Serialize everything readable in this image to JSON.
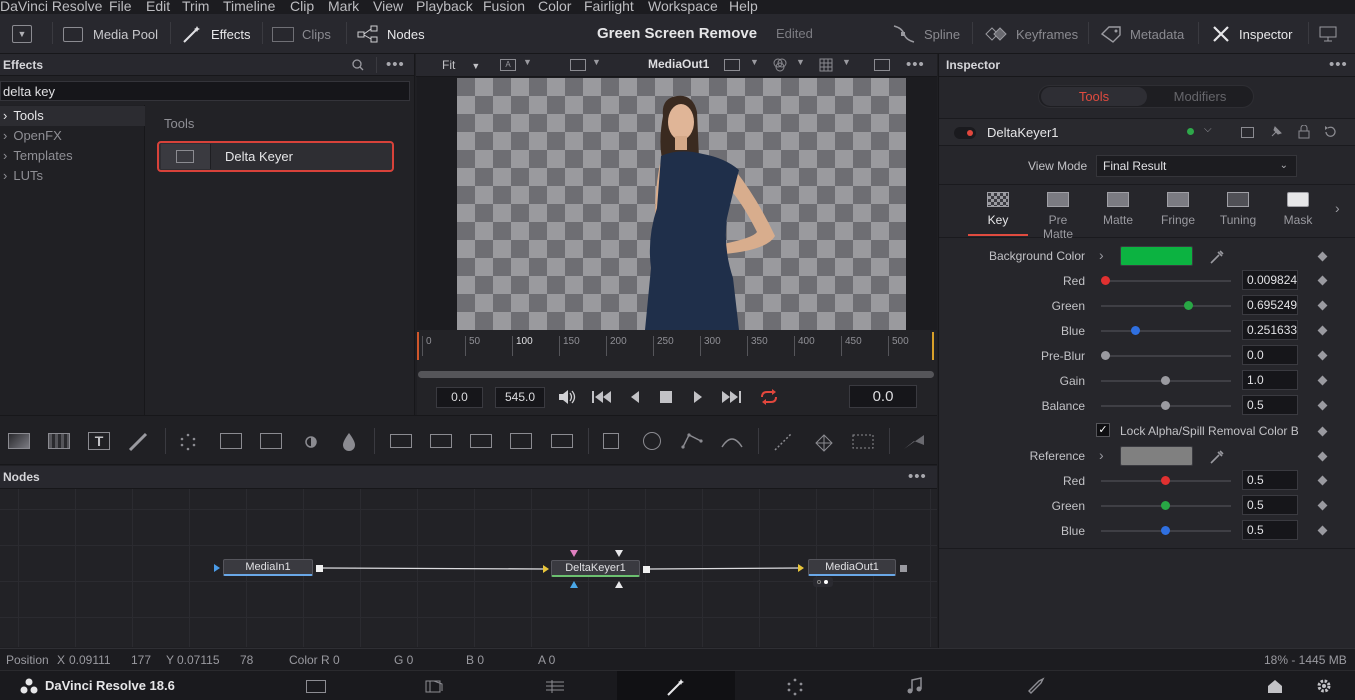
{
  "menu": [
    "DaVinci Resolve",
    "File",
    "Edit",
    "Trim",
    "Timeline",
    "Clip",
    "Mark",
    "View",
    "Playback",
    "Fusion",
    "Color",
    "Fairlight",
    "Workspace",
    "Help"
  ],
  "toolbar": {
    "media_pool": "Media Pool",
    "effects": "Effects",
    "clips": "Clips",
    "nodes": "Nodes",
    "project_title": "Green Screen Remove",
    "edited": "Edited",
    "spline": "Spline",
    "keyframes": "Keyframes",
    "metadata": "Metadata",
    "inspector": "Inspector"
  },
  "effects_panel": {
    "header": "Effects",
    "search_value": "delta key",
    "tree": [
      "Tools",
      "OpenFX",
      "Templates",
      "LUTs"
    ],
    "section_title": "Tools",
    "result_item": "Delta Keyer"
  },
  "viewer": {
    "zoom": "Fit",
    "output_name": "MediaOut1",
    "ruler_ticks": [
      "0",
      "50",
      "100",
      "150",
      "200",
      "250",
      "300",
      "350",
      "400",
      "450",
      "500"
    ],
    "start_value": "0.0",
    "end_value": "545.0",
    "current_time": "0.0"
  },
  "nodes_panel": {
    "header": "Nodes",
    "node_in": "MediaIn1",
    "node_key": "DeltaKeyer1",
    "node_out": "MediaOut1"
  },
  "inspector": {
    "header": "Inspector",
    "tab_tools": "Tools",
    "tab_modifiers": "Modifiers",
    "tool_name": "DeltaKeyer1",
    "view_mode_label": "View Mode",
    "view_mode_value": "Final Result",
    "subtabs": [
      "Key",
      "Pre Matte",
      "Matte",
      "Fringe",
      "Tuning",
      "Mask"
    ],
    "background_color_label": "Background Color",
    "bg_color": "#0cb341",
    "reference_color": "#808080",
    "params": [
      {
        "label": "Red",
        "value": "0.009824",
        "knob": 0.0,
        "color": "#e03030"
      },
      {
        "label": "Green",
        "value": "0.695249",
        "knob": 0.695,
        "color": "#28a745"
      },
      {
        "label": "Blue",
        "value": "0.251633",
        "knob": 0.25,
        "color": "#2f6fe0"
      },
      {
        "label": "Pre-Blur",
        "value": "0.0",
        "knob": 0.0,
        "color": "#9a9aa0"
      },
      {
        "label": "Gain",
        "value": "1.0",
        "knob": 0.5,
        "color": "#9a9aa0"
      },
      {
        "label": "Balance",
        "value": "0.5",
        "knob": 0.5,
        "color": "#9a9aa0"
      }
    ],
    "lock_label": "Lock Alpha/Spill Removal Color Bal",
    "reference_label": "Reference",
    "ref_params": [
      {
        "label": "Red",
        "value": "0.5",
        "knob": 0.5,
        "color": "#e03030"
      },
      {
        "label": "Green",
        "value": "0.5",
        "knob": 0.5,
        "color": "#28a745"
      },
      {
        "label": "Blue",
        "value": "0.5",
        "knob": 0.5,
        "color": "#2f6fe0"
      }
    ]
  },
  "status": {
    "position": "Position",
    "x_label": "X",
    "x_value": "0.09111",
    "x_px": "177",
    "y_label": "Y",
    "y_value": "0.07115",
    "y_px": "78",
    "color_r": "Color R 0",
    "g": "G 0",
    "b": "B 0",
    "a": "A 0",
    "memory": "18% - 1445 MB"
  },
  "app_name": "DaVinci Resolve 18.6"
}
